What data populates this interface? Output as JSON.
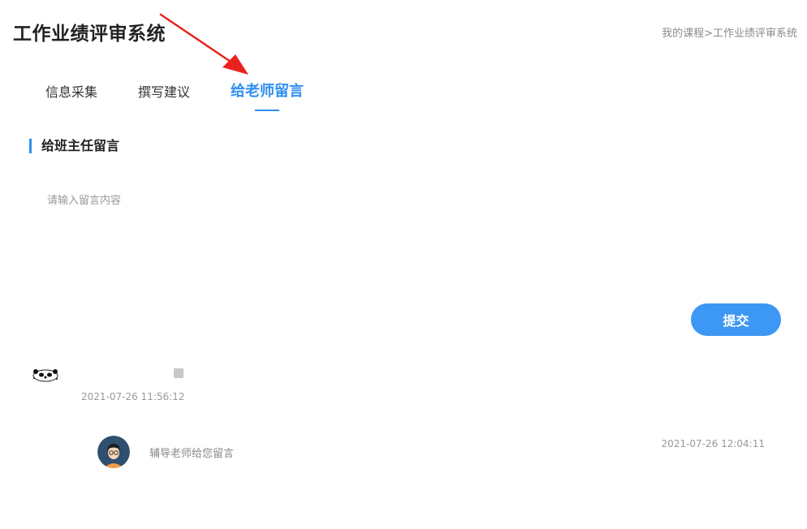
{
  "header": {
    "title": "工作业绩评审系统",
    "breadcrumb": [
      "我的课程",
      ">",
      "工作业绩评审系统"
    ]
  },
  "tabs": [
    {
      "label": "信息采集",
      "active": false
    },
    {
      "label": "撰写建议",
      "active": false
    },
    {
      "label": "给老师留言",
      "active": true
    }
  ],
  "section": {
    "title": "给班主任留言"
  },
  "form": {
    "placeholder": "请输入留言内容",
    "value": "",
    "submit_label": "提交"
  },
  "messages": [
    {
      "time": "2021-07-26 11:56:12",
      "reply": {
        "text": "辅导老师给您留言",
        "time": "2021-07-26 12:04:11"
      }
    }
  ],
  "colors": {
    "accent": "#2f8ff0",
    "button": "#3d97f4",
    "annotation_arrow": "#e8231f"
  }
}
